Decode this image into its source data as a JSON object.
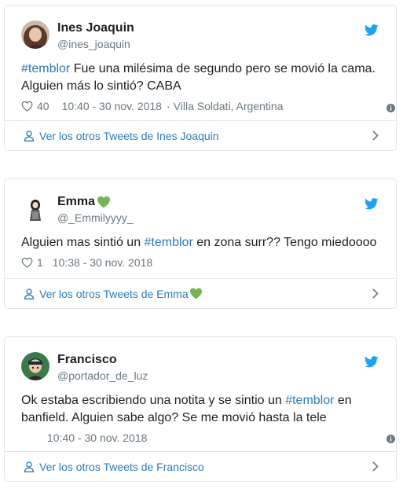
{
  "tweets": [
    {
      "display_name": "Ines Joaquin",
      "screen_name": "@ines_joaquin",
      "text_hashtag": "#temblor",
      "text_rest": " Fue una milésima de segundo pero se movió la cama. Alguien más lo sintió? CABA",
      "likes": "40",
      "time": "10:40 - 30 nov. 2018",
      "location": "Villa Soldati, Argentina",
      "footer_link": "Ver los otros Tweets de Ines Joaquin"
    },
    {
      "display_name": "Emma",
      "screen_name": "@_Emmilyyyy_",
      "text_before": "Alguien mas sintió un ",
      "text_hashtag": "#temblor",
      "text_after": " en zona surr?? Tengo miedoooo",
      "likes": "1",
      "time": "10:38 - 30 nov. 2018",
      "footer_link": "Ver los otros Tweets de Emma"
    },
    {
      "display_name": "Francisco",
      "screen_name": "@portador_de_luz",
      "text_before": "Ok estaba escribiendo una notita y se sintio un ",
      "text_hashtag": "#temblor",
      "text_after": " en banfield. Alguien sabe algo? Se me movió hasta la tele",
      "time": "10:40 - 30 nov. 2018",
      "footer_link": "Ver los otros Tweets de Francisco"
    }
  ],
  "icons": {
    "brand": "twitter-bird-icon",
    "like": "heart-outline-icon",
    "info": "info-icon",
    "profile": "person-icon",
    "chevron": "chevron-right-icon",
    "emoji": "green-heart-emoji"
  },
  "colors": {
    "link": "#2b7bb9",
    "muted": "#697882",
    "border": "#e1e8ed",
    "bird": "#1da1f2",
    "green_heart": "#77b255"
  }
}
